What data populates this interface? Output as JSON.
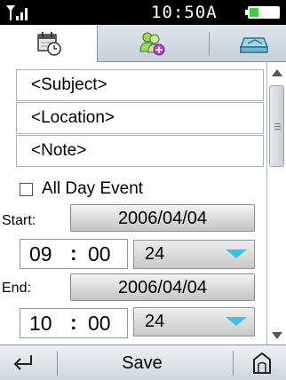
{
  "status": {
    "time": "10:50A",
    "signal_icon": "signal-strength-icon",
    "battery_icon": "battery-icon"
  },
  "tabs": [
    {
      "icon": "calendar-clock-icon",
      "active": true
    },
    {
      "icon": "add-attendee-icon",
      "active": false
    },
    {
      "icon": "reminder-icon",
      "active": false
    }
  ],
  "form": {
    "subject_placeholder": "<Subject>",
    "location_placeholder": "<Location>",
    "note_placeholder": "<Note>",
    "all_day_label": "All Day Event",
    "all_day_checked": false,
    "start_label": "Start:",
    "start_date": "2006/04/04",
    "start_hour": "09",
    "start_minute": "00",
    "start_format": "24",
    "end_label": "End:",
    "end_date": "2006/04/04",
    "end_hour": "10",
    "end_minute": "00",
    "end_format": "24",
    "time_separator": ":"
  },
  "softkeys": {
    "back_icon": "back-arrow-icon",
    "save_label": "Save",
    "home_icon": "home-icon"
  },
  "colors": {
    "dropdown_arrow": "#3cc2e6",
    "tab_bar": "#c8d0d8"
  }
}
